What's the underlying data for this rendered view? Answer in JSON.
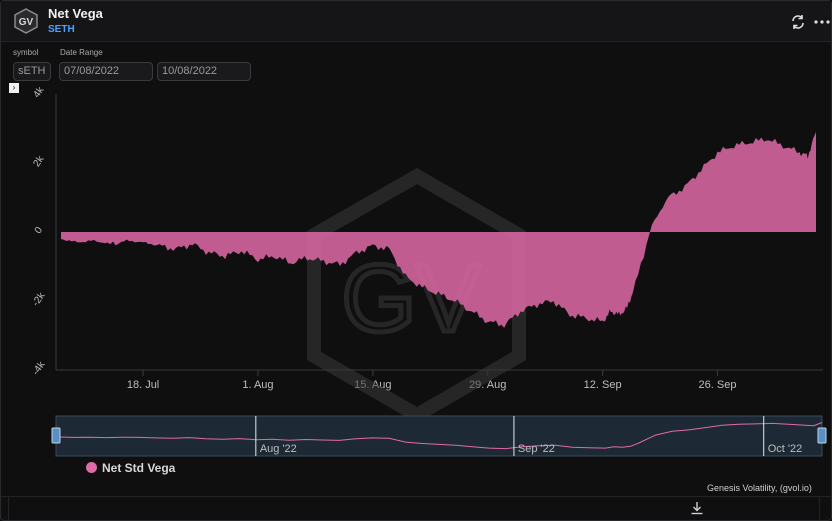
{
  "header": {
    "title": "Net Vega",
    "subtitle": "SETH",
    "logo_text": "GV"
  },
  "controls": {
    "symbol_label": "symbol",
    "symbol_value": "sETH",
    "date_range_label": "Date Range",
    "date_from": "07/08/2022",
    "date_to": "10/08/2022"
  },
  "watermark": "GV",
  "chart_data": {
    "type": "area",
    "ylim": [
      -4000,
      4000
    ],
    "y_ticks": [
      {
        "value": 4000,
        "label": "4k"
      },
      {
        "value": 2000,
        "label": "2k"
      },
      {
        "value": 0,
        "label": "0"
      },
      {
        "value": -2000,
        "label": "-2k"
      },
      {
        "value": -4000,
        "label": "-4k"
      }
    ],
    "x_ticks": [
      {
        "date": "2022-07-18",
        "label": "18. Jul"
      },
      {
        "date": "2022-08-01",
        "label": "1. Aug"
      },
      {
        "date": "2022-08-15",
        "label": "15. Aug"
      },
      {
        "date": "2022-08-29",
        "label": "29. Aug"
      },
      {
        "date": "2022-09-12",
        "label": "12. Sep"
      },
      {
        "date": "2022-09-26",
        "label": "26. Sep"
      }
    ],
    "series": [
      {
        "name": "Net Std Vega",
        "color": "#e06aa8",
        "dates": [
          "2022-07-08",
          "2022-07-10",
          "2022-07-12",
          "2022-07-14",
          "2022-07-16",
          "2022-07-18",
          "2022-07-20",
          "2022-07-22",
          "2022-07-24",
          "2022-07-26",
          "2022-07-28",
          "2022-07-30",
          "2022-08-01",
          "2022-08-03",
          "2022-08-05",
          "2022-08-07",
          "2022-08-09",
          "2022-08-11",
          "2022-08-13",
          "2022-08-15",
          "2022-08-17",
          "2022-08-19",
          "2022-08-21",
          "2022-08-23",
          "2022-08-25",
          "2022-08-27",
          "2022-08-29",
          "2022-08-31",
          "2022-09-02",
          "2022-09-04",
          "2022-09-06",
          "2022-09-08",
          "2022-09-10",
          "2022-09-12",
          "2022-09-13",
          "2022-09-14",
          "2022-09-15",
          "2022-09-16",
          "2022-09-18",
          "2022-09-20",
          "2022-09-22",
          "2022-09-24",
          "2022-09-26",
          "2022-09-28",
          "2022-09-30",
          "2022-10-02",
          "2022-10-04",
          "2022-10-06",
          "2022-10-07",
          "2022-10-08"
        ],
        "values": [
          -200,
          -300,
          -250,
          -350,
          -250,
          -300,
          -400,
          -500,
          -350,
          -600,
          -700,
          -550,
          -800,
          -700,
          -900,
          -750,
          -850,
          -950,
          -600,
          -400,
          -500,
          -1300,
          -1600,
          -1800,
          -2000,
          -2300,
          -2600,
          -2700,
          -2300,
          -2100,
          -2000,
          -2400,
          -2500,
          -2600,
          -2300,
          -2400,
          -2200,
          -1500,
          200,
          1000,
          1300,
          1800,
          2300,
          2500,
          2600,
          2700,
          2500,
          2300,
          2200,
          2900
        ]
      }
    ],
    "navigator": {
      "labels": [
        "Aug '22",
        "Sep '22",
        "Oct '22"
      ]
    }
  },
  "legend": {
    "label": "Net Std Vega"
  },
  "credit": "Genesis Volatility, (gvol.io)",
  "icons": {
    "refresh": "refresh-icon",
    "more": "more-icon",
    "download": "download-icon"
  }
}
